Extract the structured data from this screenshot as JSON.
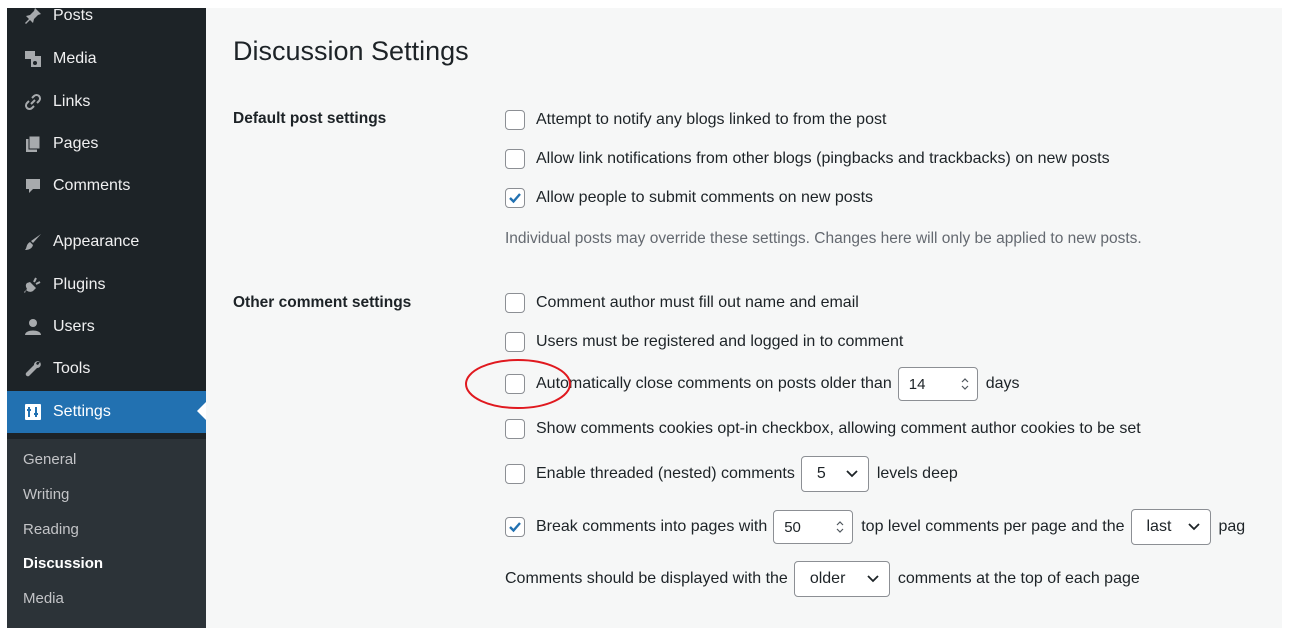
{
  "sidebar": {
    "items": [
      {
        "label": "Posts",
        "icon": "pin-icon"
      },
      {
        "label": "Media",
        "icon": "media-icon"
      },
      {
        "label": "Links",
        "icon": "link-icon"
      },
      {
        "label": "Pages",
        "icon": "page-icon"
      },
      {
        "label": "Comments",
        "icon": "comment-icon"
      },
      {
        "label": "Appearance",
        "icon": "brush-icon"
      },
      {
        "label": "Plugins",
        "icon": "plugin-icon"
      },
      {
        "label": "Users",
        "icon": "user-icon"
      },
      {
        "label": "Tools",
        "icon": "wrench-icon"
      },
      {
        "label": "Settings",
        "icon": "settings-icon"
      }
    ],
    "submenu": [
      "General",
      "Writing",
      "Reading",
      "Discussion",
      "Media"
    ],
    "active_color": "#2271b1",
    "bg_color": "#1d2327"
  },
  "main": {
    "title": "Discussion Settings",
    "default_post": {
      "label": "Default post settings",
      "options": [
        {
          "text": "Attempt to notify any blogs linked to from the post",
          "checked": false
        },
        {
          "text": "Allow link notifications from other blogs (pingbacks and trackbacks) on new posts",
          "checked": false
        },
        {
          "text": "Allow people to submit comments on new posts",
          "checked": true
        }
      ],
      "description": "Individual posts may override these settings. Changes here will only be applied to new posts."
    },
    "other_comment": {
      "label": "Other comment settings",
      "author_fill": {
        "text": "Comment author must fill out name and email",
        "checked": false
      },
      "registered": {
        "text": "Users must be registered and logged in to comment",
        "checked": false
      },
      "auto_close": {
        "text": "Automatically close comments on posts older than",
        "days_value": "14",
        "suffix": "days",
        "checked": false
      },
      "cookies": {
        "text": "Show comments cookies opt-in checkbox, allowing comment author cookies to be set",
        "checked": false
      },
      "threaded": {
        "text": "Enable threaded (nested) comments",
        "levels_value": "5",
        "suffix": "levels deep",
        "checked": false
      },
      "paging": {
        "text": "Break comments into pages with",
        "per_page_value": "50",
        "mid": "top level comments per page and the",
        "page_value": "last",
        "suffix": "pag",
        "checked": true
      },
      "order": {
        "prefix": "Comments should be displayed with the",
        "order_value": "older",
        "suffix": "comments at the top of each page"
      }
    }
  },
  "annotation_color": "#e0191f"
}
